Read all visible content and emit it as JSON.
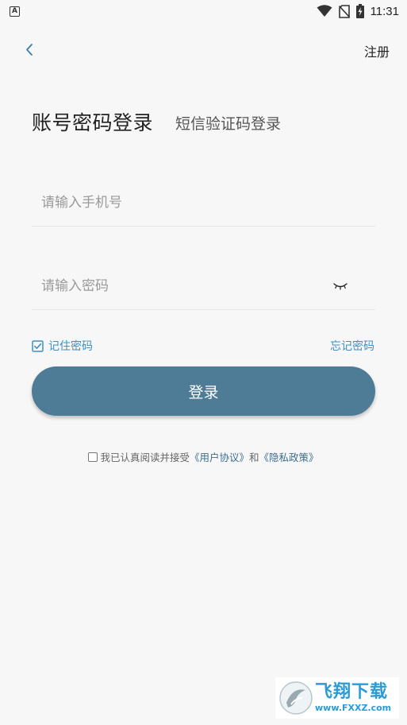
{
  "status_bar": {
    "notification_badge": "A",
    "time": "11:31"
  },
  "header": {
    "register_label": "注册"
  },
  "tabs": {
    "password_login": "账号密码登录",
    "sms_login": "短信验证码登录"
  },
  "form": {
    "phone_placeholder": "请输入手机号",
    "phone_value": "",
    "password_placeholder": "请输入密码",
    "password_value": "",
    "remember_label": "记住密码",
    "remember_checked": true,
    "forgot_label": "忘记密码",
    "login_label": "登录"
  },
  "agreement": {
    "prefix": "我已认真阅读并接受",
    "user_agreement": "《用户协议》",
    "conjunction": "和",
    "privacy_policy": "《隐私政策》",
    "checked": false
  },
  "watermark": {
    "cn": "飞翔下载",
    "en": "www.FXXZ.com"
  },
  "colors": {
    "accent": "#3d8fc8",
    "button": "#4e7c97",
    "background": "#f7f7f7",
    "link": "#3b6e8f"
  },
  "icons": {
    "back": "chevron-left-icon",
    "eye": "eye-closed-icon",
    "remember_checkbox": "checkbox-checked-icon",
    "wifi": "wifi-icon",
    "sim": "no-sim-icon",
    "battery": "battery-charging-icon"
  }
}
